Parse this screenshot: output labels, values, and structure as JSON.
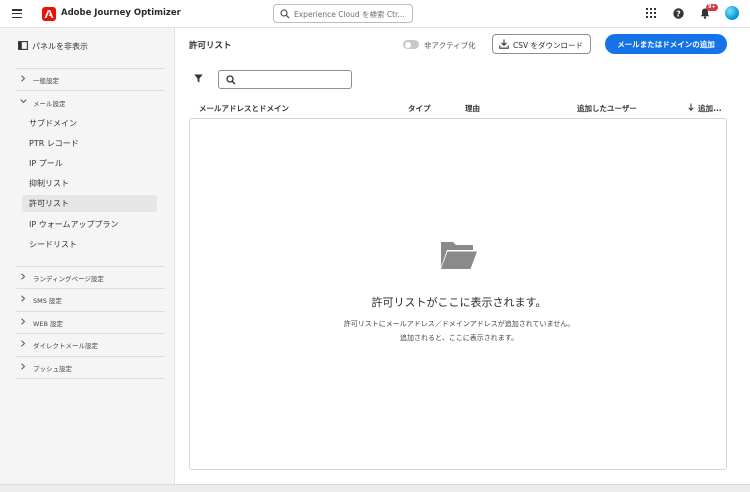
{
  "header": {
    "app_title": "Adobe Journey Optimizer",
    "search_placeholder": "Experience Cloud を検索 Ctr...",
    "notification_count": "9+",
    "icons": [
      "menu-icon",
      "adobe-logo-icon",
      "search-icon",
      "apps-grid-icon",
      "help-icon",
      "bell-icon",
      "avatar"
    ]
  },
  "sidebar": {
    "toggle_label": "パネルを非表示",
    "sections": [
      {
        "label": "一般設定",
        "expanded": false
      },
      {
        "label": "メール設定",
        "expanded": true,
        "items": [
          {
            "label": "サブドメイン"
          },
          {
            "label": "PTR レコード"
          },
          {
            "label": "IP プール"
          },
          {
            "label": "抑制リスト"
          },
          {
            "label": "許可リスト",
            "active": true
          },
          {
            "label": "IP ウォームアッププラン"
          },
          {
            "label": "シードリスト"
          }
        ]
      },
      {
        "label": "ランディングページ設定",
        "expanded": false
      },
      {
        "label": "SMS 設定",
        "expanded": false
      },
      {
        "label": "WEB 設定",
        "expanded": false
      },
      {
        "label": "ダイレクトメール設定",
        "expanded": false
      },
      {
        "label": "プッシュ設定",
        "expanded": false
      }
    ]
  },
  "main": {
    "title": "許可リスト",
    "toggle_label": "非アクティブ化",
    "csv_button": "CSV をダウンロード",
    "add_button": "メールまたはドメインの追加",
    "search_value": "",
    "columns": [
      "メールアドレスとドメイン",
      "タイプ",
      "理由",
      "追加したユーザー",
      "追加..."
    ],
    "empty": {
      "title": "許可リストがここに表示されます。",
      "line1": "許可リストにメールアドレス／ドメインアドレスが追加されていません。",
      "line2": "追加されると、ここに表示されます。"
    }
  },
  "colors": {
    "accent": "#1473e6",
    "logo": "#eb1000",
    "badge": "#d7373f"
  }
}
